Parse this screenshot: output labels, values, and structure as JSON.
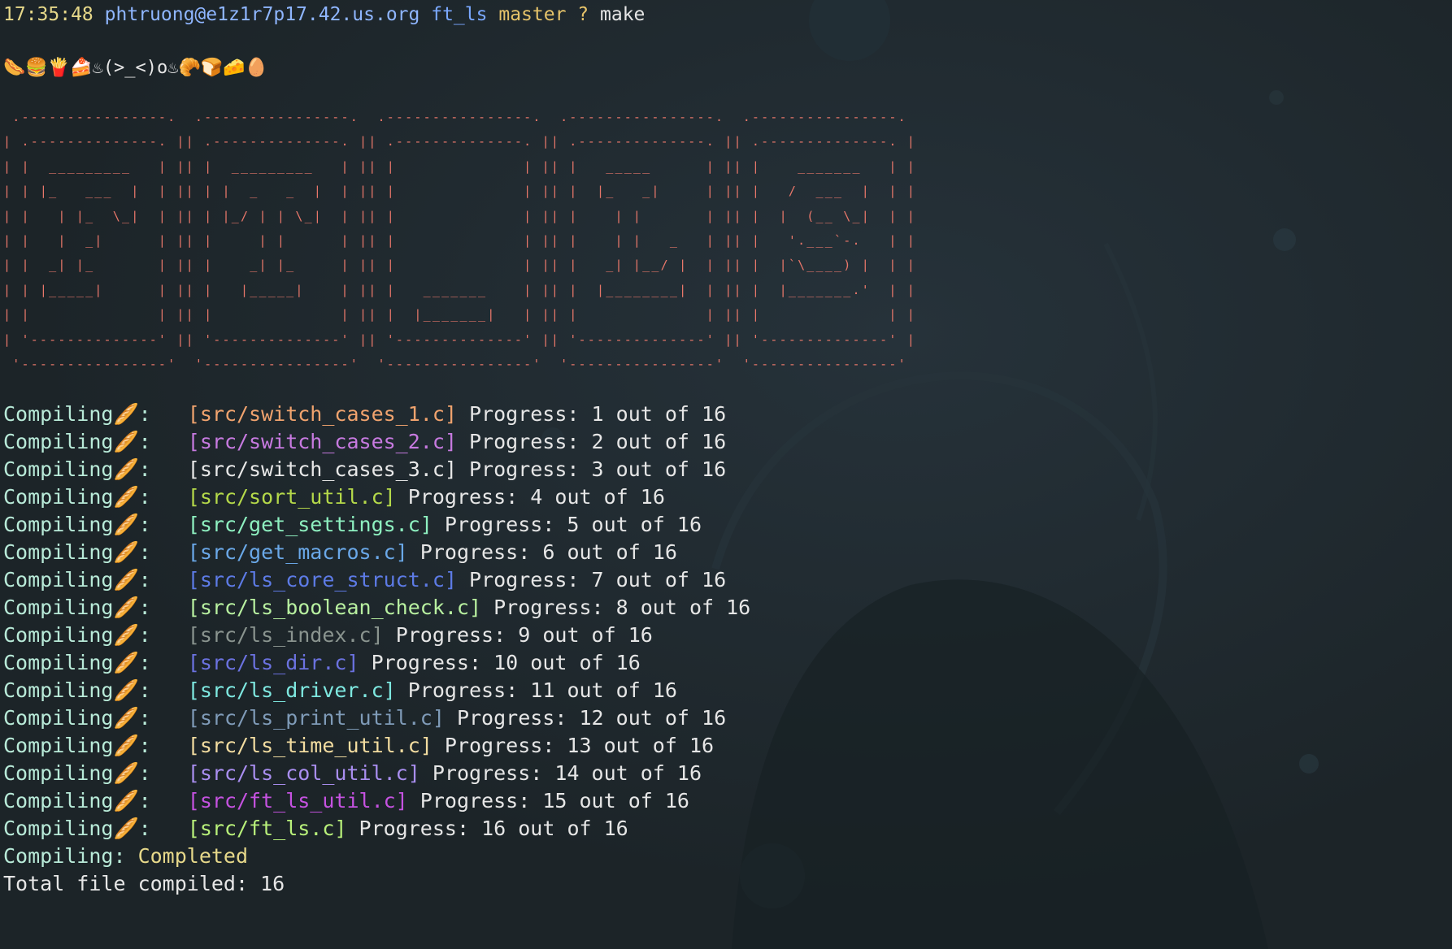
{
  "colors": {
    "background": "#1c2428",
    "time": "#e6d88a",
    "host": "#7ab0ff",
    "dir": "#7aa8ff",
    "branch": "#e6c36a",
    "question": "#e6c36a",
    "ascii": "#e8776a",
    "completed": "#e6d88a"
  },
  "prompt": {
    "time": "17:35:48",
    "user_host": "phtruong@e1z1r7p17.42.us.org",
    "dir": "ft_ls",
    "branch": "master",
    "status": "?",
    "command": "make"
  },
  "emoji_line": "🌭🍔🍟🍰♨(>_<)o♨🥐🍞🧀🥚",
  "ascii_art": [
    " .----------------.  .----------------.  .----------------.  .----------------.  .----------------.",
    "| .--------------. || .--------------. || .--------------. || .--------------. || .--------------. |",
    "| |  _________   | || |  _________   | || |              | || |   _____      | || |    _______   | |",
    "| | |_   ___  |  | || | |  _   _  |  | || |              | || |  |_   _|     | || |   /  ___  |  | |",
    "| |   | |_  \\_|  | || | |_/ | | \\_|  | || |              | || |    | |       | || |  |  (__ \\_|  | |",
    "| |   |  _|      | || |     | |      | || |              | || |    | |   _   | || |   '.___`-.   | |",
    "| |  _| |_       | || |    _| |_     | || |              | || |   _| |__/ |  | || |  |`\\____) |  | |",
    "| | |_____|      | || |   |_____|    | || |   _______    | || |  |________|  | || |  |_______.'  | |",
    "| |              | || |              | || |  |_______|   | || |              | || |              | |",
    "| '--------------' || '--------------' || '--------------' || '--------------' || '--------------' |",
    " '----------------'  '----------------'  '----------------'  '----------------'  '----------------'"
  ],
  "compile": {
    "prefix": "Compiling🥖:",
    "progress_label": "Progress:",
    "out_of_label": "out of",
    "total": "16",
    "entries": [
      {
        "file": "[src/switch_cases_1.c]",
        "index": "1",
        "color": "#f0a36e"
      },
      {
        "file": "[src/switch_cases_2.c]",
        "index": "2",
        "color": "#c77ae0"
      },
      {
        "file": "[src/switch_cases_3.c]",
        "index": "3",
        "color": "#e8e8e8"
      },
      {
        "file": "[src/sort_util.c]",
        "index": "4",
        "color": "#b5d94a"
      },
      {
        "file": "[src/get_settings.c]",
        "index": "5",
        "color": "#8ef0c0"
      },
      {
        "file": "[src/get_macros.c]",
        "index": "6",
        "color": "#6aa8e8"
      },
      {
        "file": "[src/ls_core_struct.c]",
        "index": "7",
        "color": "#5d7be6"
      },
      {
        "file": "[src/ls_boolean_check.c]",
        "index": "8",
        "color": "#b8f0a0"
      },
      {
        "file": "[src/ls_index.c]",
        "index": "9",
        "color": "#8a948f"
      },
      {
        "file": "[src/ls_dir.c]",
        "index": "10",
        "color": "#6b72e0"
      },
      {
        "file": "[src/ls_driver.c]",
        "index": "11",
        "color": "#7ee8e0"
      },
      {
        "file": "[src/ls_print_util.c]",
        "index": "12",
        "color": "#7f9bb8"
      },
      {
        "file": "[src/ls_time_util.c]",
        "index": "13",
        "color": "#f2dca0"
      },
      {
        "file": "[src/ls_col_util.c]",
        "index": "14",
        "color": "#a98ef0"
      },
      {
        "file": "[src/ft_ls_util.c]",
        "index": "15",
        "color": "#c552e0"
      },
      {
        "file": "[src/ft_ls.c]",
        "index": "16",
        "color": "#b8f07a"
      }
    ],
    "completed_label": "Compiling:",
    "completed_value": "Completed",
    "total_label": "Total file compiled:",
    "total_value": "16"
  }
}
